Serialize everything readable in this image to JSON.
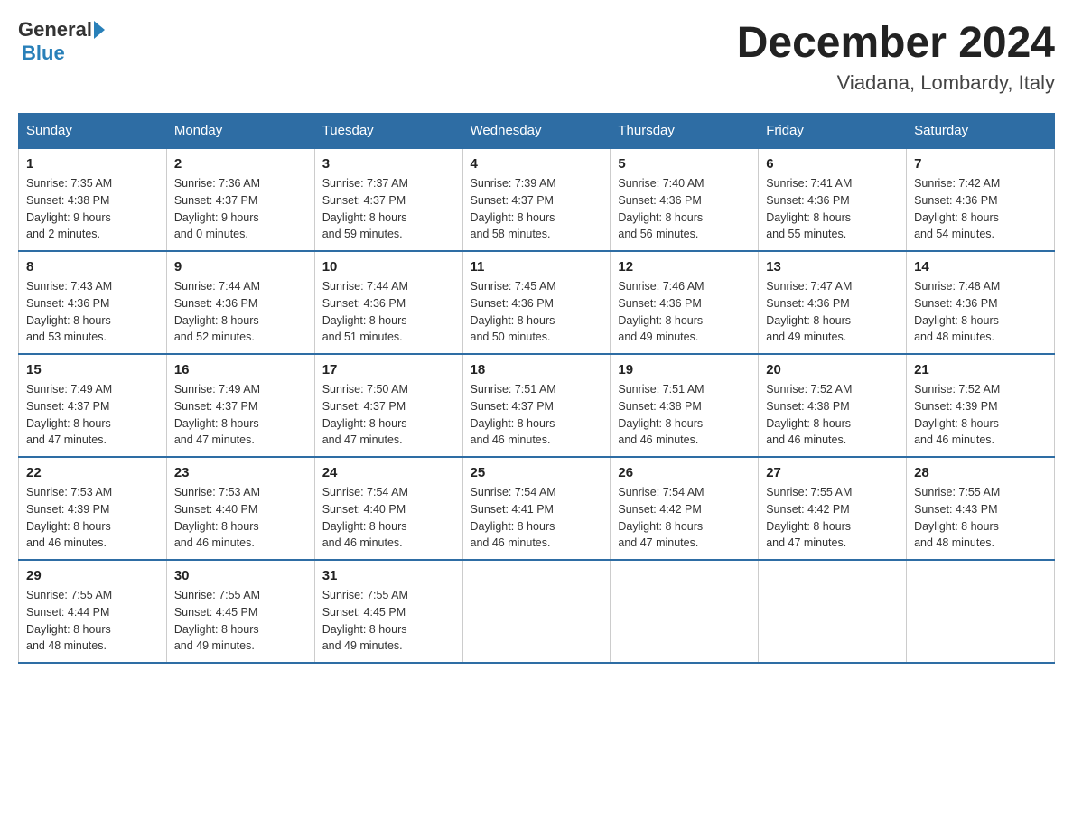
{
  "header": {
    "logo": {
      "general": "General",
      "blue": "Blue"
    },
    "title": "December 2024",
    "location": "Viadana, Lombardy, Italy"
  },
  "days_of_week": [
    "Sunday",
    "Monday",
    "Tuesday",
    "Wednesday",
    "Thursday",
    "Friday",
    "Saturday"
  ],
  "weeks": [
    [
      {
        "day": "1",
        "sunrise": "7:35 AM",
        "sunset": "4:38 PM",
        "daylight": "9 hours and 2 minutes."
      },
      {
        "day": "2",
        "sunrise": "7:36 AM",
        "sunset": "4:37 PM",
        "daylight": "9 hours and 0 minutes."
      },
      {
        "day": "3",
        "sunrise": "7:37 AM",
        "sunset": "4:37 PM",
        "daylight": "8 hours and 59 minutes."
      },
      {
        "day": "4",
        "sunrise": "7:39 AM",
        "sunset": "4:37 PM",
        "daylight": "8 hours and 58 minutes."
      },
      {
        "day": "5",
        "sunrise": "7:40 AM",
        "sunset": "4:36 PM",
        "daylight": "8 hours and 56 minutes."
      },
      {
        "day": "6",
        "sunrise": "7:41 AM",
        "sunset": "4:36 PM",
        "daylight": "8 hours and 55 minutes."
      },
      {
        "day": "7",
        "sunrise": "7:42 AM",
        "sunset": "4:36 PM",
        "daylight": "8 hours and 54 minutes."
      }
    ],
    [
      {
        "day": "8",
        "sunrise": "7:43 AM",
        "sunset": "4:36 PM",
        "daylight": "8 hours and 53 minutes."
      },
      {
        "day": "9",
        "sunrise": "7:44 AM",
        "sunset": "4:36 PM",
        "daylight": "8 hours and 52 minutes."
      },
      {
        "day": "10",
        "sunrise": "7:44 AM",
        "sunset": "4:36 PM",
        "daylight": "8 hours and 51 minutes."
      },
      {
        "day": "11",
        "sunrise": "7:45 AM",
        "sunset": "4:36 PM",
        "daylight": "8 hours and 50 minutes."
      },
      {
        "day": "12",
        "sunrise": "7:46 AM",
        "sunset": "4:36 PM",
        "daylight": "8 hours and 49 minutes."
      },
      {
        "day": "13",
        "sunrise": "7:47 AM",
        "sunset": "4:36 PM",
        "daylight": "8 hours and 49 minutes."
      },
      {
        "day": "14",
        "sunrise": "7:48 AM",
        "sunset": "4:36 PM",
        "daylight": "8 hours and 48 minutes."
      }
    ],
    [
      {
        "day": "15",
        "sunrise": "7:49 AM",
        "sunset": "4:37 PM",
        "daylight": "8 hours and 47 minutes."
      },
      {
        "day": "16",
        "sunrise": "7:49 AM",
        "sunset": "4:37 PM",
        "daylight": "8 hours and 47 minutes."
      },
      {
        "day": "17",
        "sunrise": "7:50 AM",
        "sunset": "4:37 PM",
        "daylight": "8 hours and 47 minutes."
      },
      {
        "day": "18",
        "sunrise": "7:51 AM",
        "sunset": "4:37 PM",
        "daylight": "8 hours and 46 minutes."
      },
      {
        "day": "19",
        "sunrise": "7:51 AM",
        "sunset": "4:38 PM",
        "daylight": "8 hours and 46 minutes."
      },
      {
        "day": "20",
        "sunrise": "7:52 AM",
        "sunset": "4:38 PM",
        "daylight": "8 hours and 46 minutes."
      },
      {
        "day": "21",
        "sunrise": "7:52 AM",
        "sunset": "4:39 PM",
        "daylight": "8 hours and 46 minutes."
      }
    ],
    [
      {
        "day": "22",
        "sunrise": "7:53 AM",
        "sunset": "4:39 PM",
        "daylight": "8 hours and 46 minutes."
      },
      {
        "day": "23",
        "sunrise": "7:53 AM",
        "sunset": "4:40 PM",
        "daylight": "8 hours and 46 minutes."
      },
      {
        "day": "24",
        "sunrise": "7:54 AM",
        "sunset": "4:40 PM",
        "daylight": "8 hours and 46 minutes."
      },
      {
        "day": "25",
        "sunrise": "7:54 AM",
        "sunset": "4:41 PM",
        "daylight": "8 hours and 46 minutes."
      },
      {
        "day": "26",
        "sunrise": "7:54 AM",
        "sunset": "4:42 PM",
        "daylight": "8 hours and 47 minutes."
      },
      {
        "day": "27",
        "sunrise": "7:55 AM",
        "sunset": "4:42 PM",
        "daylight": "8 hours and 47 minutes."
      },
      {
        "day": "28",
        "sunrise": "7:55 AM",
        "sunset": "4:43 PM",
        "daylight": "8 hours and 48 minutes."
      }
    ],
    [
      {
        "day": "29",
        "sunrise": "7:55 AM",
        "sunset": "4:44 PM",
        "daylight": "8 hours and 48 minutes."
      },
      {
        "day": "30",
        "sunrise": "7:55 AM",
        "sunset": "4:45 PM",
        "daylight": "8 hours and 49 minutes."
      },
      {
        "day": "31",
        "sunrise": "7:55 AM",
        "sunset": "4:45 PM",
        "daylight": "8 hours and 49 minutes."
      },
      null,
      null,
      null,
      null
    ]
  ],
  "labels": {
    "sunrise": "Sunrise:",
    "sunset": "Sunset:",
    "daylight": "Daylight:"
  }
}
